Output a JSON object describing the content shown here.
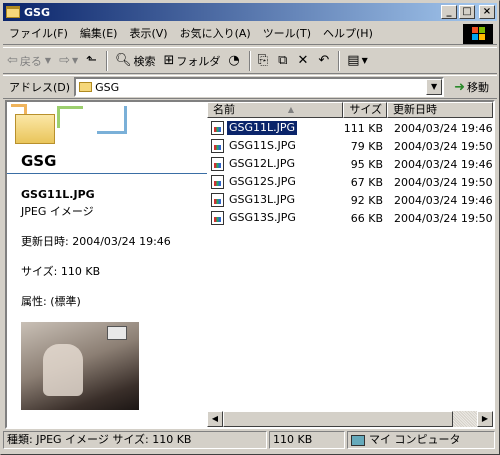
{
  "window": {
    "title": "GSG"
  },
  "menu": [
    "ファイル(F)",
    "編集(E)",
    "表示(V)",
    "お気に入り(A)",
    "ツール(T)",
    "ヘルプ(H)"
  ],
  "toolbar": {
    "back": "戻る",
    "search": "検索",
    "folders": "フォルダ"
  },
  "address": {
    "label": "アドレス(D)",
    "value": "GSG",
    "go": "移動"
  },
  "left_pane": {
    "folder_title": "GSG",
    "file_name": "GSG11L.JPG",
    "file_type": "JPEG イメージ",
    "modified": "更新日時: 2004/03/24 19:46",
    "size": "サイズ: 110 KB",
    "attributes": "属性: (標準)"
  },
  "list": {
    "columns": {
      "name": "名前",
      "size": "サイズ",
      "date": "更新日時"
    },
    "rows": [
      {
        "name": "GSG11L.JPG",
        "size": "111 KB",
        "date": "2004/03/24 19:46",
        "selected": true
      },
      {
        "name": "GSG11S.JPG",
        "size": "79 KB",
        "date": "2004/03/24 19:50"
      },
      {
        "name": "GSG12L.JPG",
        "size": "95 KB",
        "date": "2004/03/24 19:46"
      },
      {
        "name": "GSG12S.JPG",
        "size": "67 KB",
        "date": "2004/03/24 19:50"
      },
      {
        "name": "GSG13L.JPG",
        "size": "92 KB",
        "date": "2004/03/24 19:46"
      },
      {
        "name": "GSG13S.JPG",
        "size": "66 KB",
        "date": "2004/03/24 19:50"
      }
    ]
  },
  "status": {
    "info": "種類: JPEG イメージ サイズ: 110 KB",
    "size": "110 KB",
    "zone": "マイ コンピュータ"
  },
  "colors": {
    "titlebar_start": "#0a246a",
    "titlebar_end": "#a6caf0",
    "selection": "#0a246a"
  }
}
